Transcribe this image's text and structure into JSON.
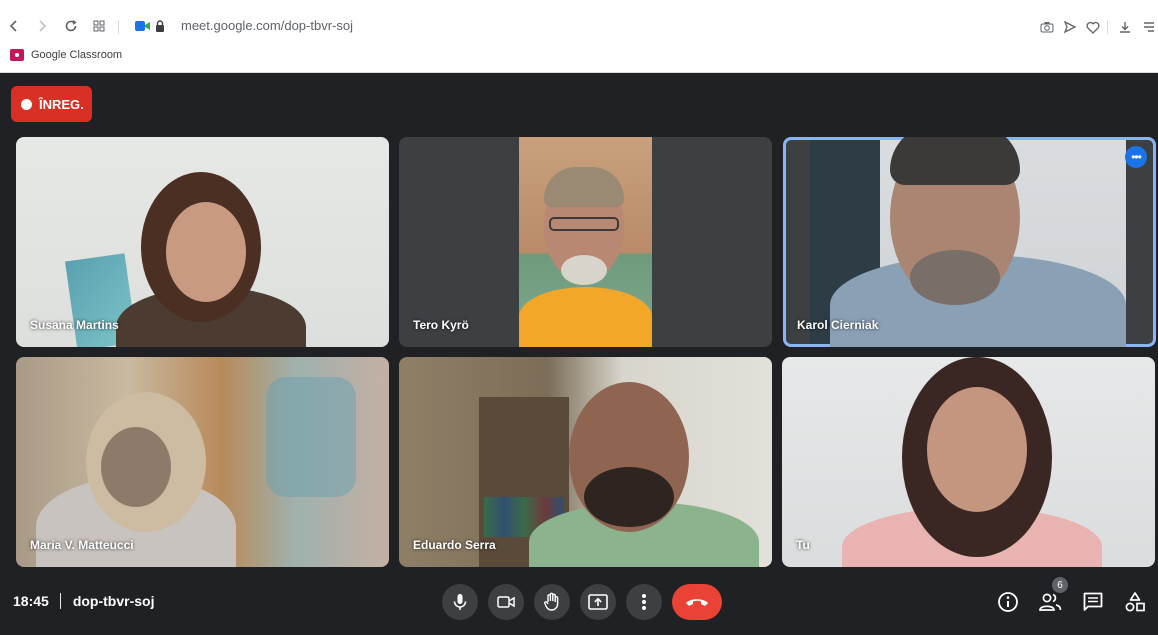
{
  "browser": {
    "url": "meet.google.com/dop-tbvr-soj",
    "bookmark": "Google Classroom"
  },
  "recording": {
    "label": "ÎNREG."
  },
  "participants": [
    {
      "name": "Susana Martins"
    },
    {
      "name": "Tero Kyrö"
    },
    {
      "name": "Karol Cierniak"
    },
    {
      "name": "Maria V. Matteucci"
    },
    {
      "name": "Eduardo Serra"
    },
    {
      "name": "Tu"
    }
  ],
  "footer": {
    "time": "18:45",
    "meeting_code": "dop-tbvr-soj",
    "participant_count": "6"
  },
  "colors": {
    "background": "#202124",
    "recording_badge": "#d93025",
    "hangup": "#ea4335",
    "active_speaker": "#8ab4f8"
  }
}
